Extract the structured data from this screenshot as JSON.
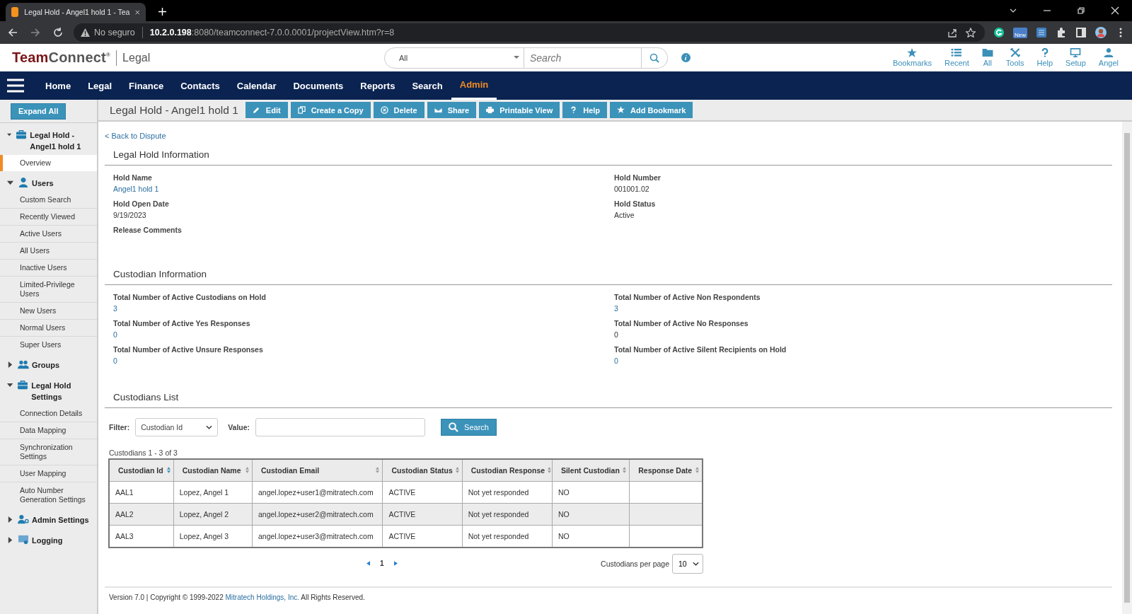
{
  "browser": {
    "tab_title": "Legal Hold - Angel1 hold 1 - Tea",
    "security_label": "No seguro",
    "url_host": "10.2.0.198",
    "url_rest": ":8080/teamconnect-7.0.0.0001/projectView.htm?r=8",
    "extension_badge": "New"
  },
  "header": {
    "logo_part_1": "Team",
    "logo_part_2": "Connect",
    "logo_mark": "®",
    "product": "Legal",
    "search_scope": "All",
    "search_placeholder": "Search",
    "tools": [
      {
        "kind": "star",
        "label": "Bookmarks"
      },
      {
        "kind": "list",
        "label": "Recent"
      },
      {
        "kind": "folder",
        "label": "All"
      },
      {
        "kind": "tools",
        "label": "Tools"
      },
      {
        "kind": "help",
        "label": "Help"
      },
      {
        "kind": "monitor",
        "label": "Setup"
      },
      {
        "kind": "user",
        "label": "Angel"
      }
    ]
  },
  "nav": [
    {
      "label": "Home",
      "selected": false
    },
    {
      "label": "Legal",
      "selected": false
    },
    {
      "label": "Finance",
      "selected": false
    },
    {
      "label": "Contacts",
      "selected": false
    },
    {
      "label": "Calendar",
      "selected": false
    },
    {
      "label": "Documents",
      "selected": false
    },
    {
      "label": "Reports",
      "selected": false
    },
    {
      "label": "Search",
      "selected": false
    },
    {
      "label": "Admin",
      "selected": true
    }
  ],
  "sidebar": {
    "expand_all": "Expand All",
    "groups": [
      {
        "kind": "briefcase",
        "label": "Legal Hold - Angel1 hold 1",
        "expanded": true,
        "items": [
          {
            "label": "Overview",
            "selected": true
          }
        ]
      },
      {
        "kind": "user",
        "label": "Users",
        "expanded": true,
        "items": [
          {
            "label": "Custom Search",
            "selected": false
          },
          {
            "label": "Recently Viewed",
            "selected": false
          },
          {
            "label": "Active Users",
            "selected": false
          },
          {
            "label": "All Users",
            "selected": false
          },
          {
            "label": "Inactive Users",
            "selected": false
          },
          {
            "label": "Limited-Privilege Users",
            "selected": false
          },
          {
            "label": "New Users",
            "selected": false
          },
          {
            "label": "Normal Users",
            "selected": false
          },
          {
            "label": "Super Users",
            "selected": false
          }
        ]
      },
      {
        "kind": "users",
        "label": "Groups",
        "expanded": false
      },
      {
        "kind": "briefcase",
        "label": "Legal Hold Settings",
        "expanded": true,
        "items": [
          {
            "label": "Connection Details",
            "selected": false
          },
          {
            "label": "Data Mapping",
            "selected": false
          },
          {
            "label": "Synchronization Settings",
            "selected": false
          },
          {
            "label": "User Mapping",
            "selected": false
          },
          {
            "label": "Auto Number Generation Settings",
            "selected": false
          }
        ]
      },
      {
        "kind": "user-gear",
        "label": "Admin Settings",
        "expanded": false
      },
      {
        "kind": "monitor",
        "label": "Logging",
        "expanded": false
      }
    ]
  },
  "toolbar": {
    "title": "Legal Hold - Angel1 hold 1",
    "buttons": [
      {
        "kind": "pencil",
        "label": "Edit"
      },
      {
        "kind": "copy",
        "label": "Create a Copy"
      },
      {
        "kind": "delete",
        "label": "Delete"
      },
      {
        "kind": "mail",
        "label": "Share"
      },
      {
        "kind": "print",
        "label": "Printable View"
      },
      {
        "kind": "help",
        "label": "Help"
      },
      {
        "kind": "star",
        "label": "Add Bookmark"
      }
    ]
  },
  "back_link": "< Back to Dispute",
  "sections": [
    {
      "title": "Legal Hold Information",
      "fields": [
        {
          "label": "Hold Name",
          "value": "Angel1 hold 1",
          "link": true
        },
        {
          "label": "Hold Number",
          "value": "001001.02",
          "link": false
        },
        {
          "label": "Hold Open Date",
          "value": "9/19/2023",
          "link": false
        },
        {
          "label": "Hold Status",
          "value": "Active",
          "link": false
        },
        {
          "label": "Release Comments"
        }
      ]
    },
    {
      "title": "Custodian Information",
      "fields": [
        {
          "label": "Total Number of Active Custodians on Hold",
          "value": "3",
          "link": true
        },
        {
          "label": "Total Number of Active Non Respondents",
          "value": "3",
          "link": true
        },
        {
          "label": "Total Number of Active Yes Responses",
          "value": "0",
          "link": true
        },
        {
          "label": "Total Number of Active No Responses",
          "value": "0",
          "link": false
        },
        {
          "label": "Total Number of Active Unsure Responses",
          "value": "0",
          "link": true
        },
        {
          "label": "Total Number of Active Silent Recipients on Hold",
          "value": "0",
          "link": true
        }
      ]
    }
  ],
  "custodians": {
    "title": "Custodians List",
    "filter_label": "Filter:",
    "filter_value": "Custodian Id",
    "value_label": "Value:",
    "search_button": "Search",
    "count": "Custodians 1 - 3 of 3",
    "columns": [
      {
        "label": "Custodian Id",
        "sorted": true
      },
      {
        "label": "Custodian Name",
        "sorted": false
      },
      {
        "label": "Custodian Email",
        "sorted": false
      },
      {
        "label": "Custodian Status",
        "sorted": false
      },
      {
        "label": "Custodian Response",
        "sorted": false
      },
      {
        "label": "Silent Custodian",
        "sorted": false
      },
      {
        "label": "Response Date",
        "sorted": false
      }
    ],
    "rows": [
      [
        "AAL1",
        "Lopez, Angel 1",
        "angel.lopez+user1@mitratech.com",
        "ACTIVE",
        "Not yet responded",
        "NO"
      ],
      [
        "AAL2",
        "Lopez, Angel 2",
        "angel.lopez+user2@mitratech.com",
        "ACTIVE",
        "Not yet responded",
        "NO"
      ],
      [
        "AAL3",
        "Lopez, Angel 3",
        "angel.lopez+user3@mitratech.com",
        "ACTIVE",
        "Not yet responded",
        "NO"
      ]
    ],
    "page": "1",
    "per_page_label": "Custodians per page",
    "per_page": "10"
  },
  "footer": {
    "text_before": "Version 7.0 | Copyright © 1999-2022 ",
    "link": "Mitratech Holdings, Inc.",
    "text_after": " All Rights Reserved."
  }
}
